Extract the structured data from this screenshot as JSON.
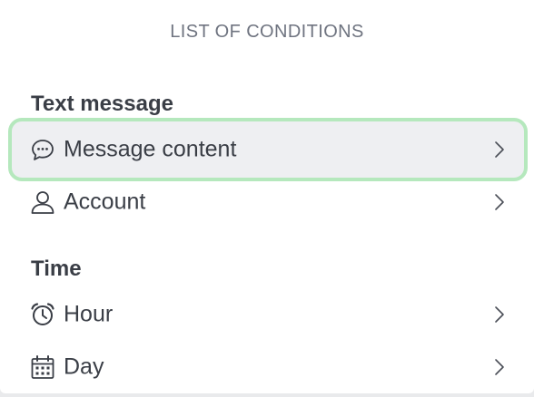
{
  "panel": {
    "title": "LIST OF CONDITIONS"
  },
  "sections": [
    {
      "title": "Text message",
      "items": [
        {
          "label": "Message content",
          "icon": "chat-bubble-icon",
          "selected": true
        },
        {
          "label": "Account",
          "icon": "user-icon",
          "selected": false
        }
      ]
    },
    {
      "title": "Time",
      "items": [
        {
          "label": "Hour",
          "icon": "alarm-clock-icon",
          "selected": false
        },
        {
          "label": "Day",
          "icon": "calendar-icon",
          "selected": false
        }
      ]
    }
  ],
  "colors": {
    "selected_border": "#b5e8bd",
    "selected_background": "#eeeff2",
    "text": "#3a3e46",
    "muted_text": "#6f7480"
  }
}
